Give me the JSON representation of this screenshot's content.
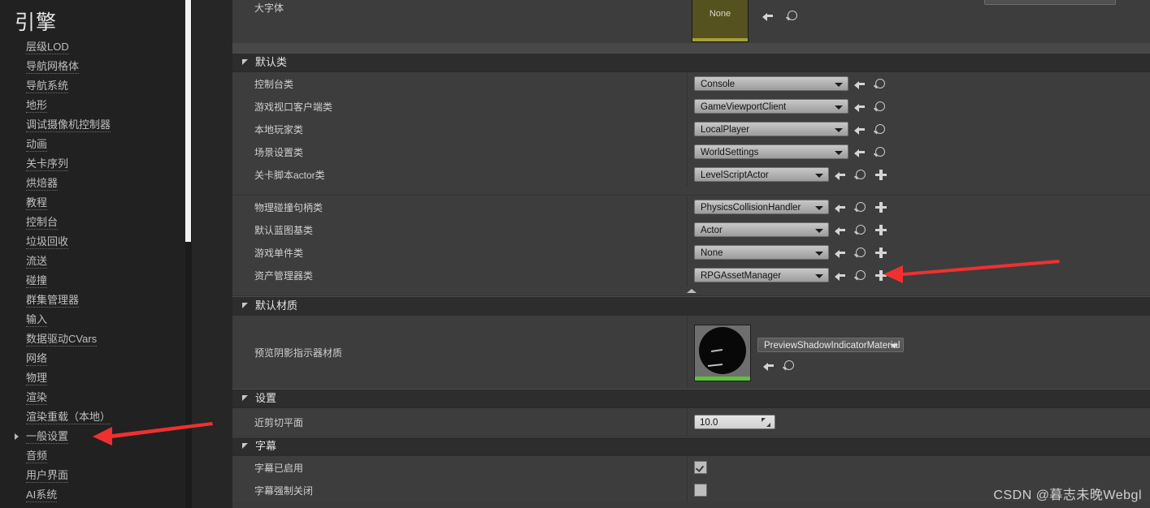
{
  "sidebar": {
    "title": "引擎",
    "items": [
      {
        "label": "层级LOD",
        "expandable": false
      },
      {
        "label": "导航网格体",
        "expandable": false
      },
      {
        "label": "导航系统",
        "expandable": false
      },
      {
        "label": "地形",
        "expandable": false
      },
      {
        "label": "调试摄像机控制器",
        "expandable": false
      },
      {
        "label": "动画",
        "expandable": false
      },
      {
        "label": "关卡序列",
        "expandable": false
      },
      {
        "label": "烘焙器",
        "expandable": false
      },
      {
        "label": "教程",
        "expandable": false
      },
      {
        "label": "控制台",
        "expandable": false
      },
      {
        "label": "垃圾回收",
        "expandable": false
      },
      {
        "label": "流送",
        "expandable": false
      },
      {
        "label": "碰撞",
        "expandable": false
      },
      {
        "label": "群集管理器",
        "expandable": false
      },
      {
        "label": "输入",
        "expandable": false
      },
      {
        "label": "数据驱动CVars",
        "expandable": false
      },
      {
        "label": "网络",
        "expandable": false
      },
      {
        "label": "物理",
        "expandable": false
      },
      {
        "label": "渲染",
        "expandable": false
      },
      {
        "label": "渲染重载（本地）",
        "expandable": false
      },
      {
        "label": "一般设置",
        "expandable": true
      },
      {
        "label": "音频",
        "expandable": false
      },
      {
        "label": "用户界面",
        "expandable": false
      },
      {
        "label": "AI系统",
        "expandable": false
      }
    ]
  },
  "details": {
    "top_partial": {
      "label": "大字体",
      "thumbnail_caption": "None"
    },
    "sections": [
      {
        "id": "default-classes",
        "title": "默认类",
        "rows": [
          {
            "label": "控制台类",
            "value": "Console",
            "combo_width": "w190",
            "has_plus": false
          },
          {
            "label": "游戏视口客户端类",
            "value": "GameViewportClient",
            "combo_width": "w190",
            "has_plus": false
          },
          {
            "label": "本地玩家类",
            "value": "LocalPlayer",
            "combo_width": "w190",
            "has_plus": false
          },
          {
            "label": "场景设置类",
            "value": "WorldSettings",
            "combo_width": "w190",
            "has_plus": false
          },
          {
            "label": "关卡脚本actor类",
            "value": "LevelScriptActor",
            "combo_width": "w166",
            "has_plus": true
          }
        ],
        "rows2": [
          {
            "label": "物理碰撞句柄类",
            "value": "PhysicsCollisionHandler",
            "combo_width": "w166",
            "has_plus": true
          },
          {
            "label": "默认蓝图基类",
            "value": "Actor",
            "combo_width": "w166",
            "has_plus": true
          },
          {
            "label": "游戏单件类",
            "value": "None",
            "combo_width": "w166",
            "has_plus": true
          },
          {
            "label": "资产管理器类",
            "value": "RPGAssetManager",
            "combo_width": "w166",
            "has_plus": true
          }
        ]
      },
      {
        "id": "default-materials",
        "title": "默认材质",
        "material_row": {
          "label": "预览阴影指示器材质",
          "value": "PreviewShadowIndicatorMaterial"
        }
      },
      {
        "id": "settings",
        "title": "设置",
        "rows": [
          {
            "label": "近剪切平面",
            "value": "10.0"
          }
        ]
      },
      {
        "id": "subtitles",
        "title": "字幕",
        "rows": [
          {
            "label": "字幕已启用",
            "checked": true
          },
          {
            "label": "字幕强制关闭",
            "checked": false
          }
        ]
      }
    ]
  },
  "annotations": {
    "arrow_color": "#f03030",
    "watermark": "CSDN @暮志未晚Webgl"
  }
}
